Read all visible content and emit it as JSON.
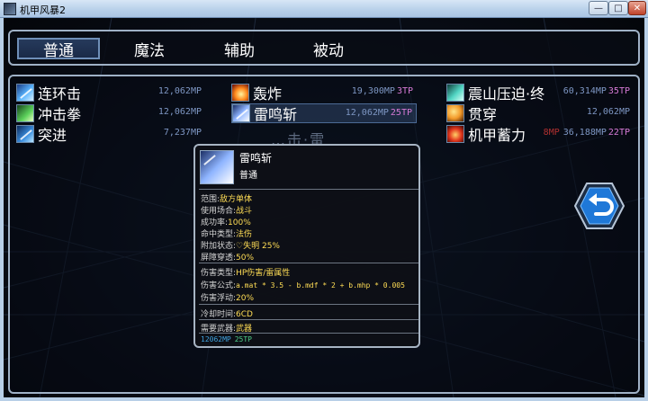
{
  "window": {
    "title": "机甲风暴2",
    "controls": {
      "minimize": "—",
      "maximize": "□",
      "close": "✕"
    }
  },
  "tabs": [
    {
      "label": "普通",
      "active": true
    },
    {
      "label": "魔法",
      "active": false
    },
    {
      "label": "辅助",
      "active": false
    },
    {
      "label": "被动",
      "active": false
    }
  ],
  "skills": [
    {
      "name": "连环击",
      "mp": "12,062MP",
      "tp": "",
      "icon": "blue-slash-icon"
    },
    {
      "name": "冲击拳",
      "mp": "12,062MP",
      "tp": "",
      "icon": "green-fist-icon"
    },
    {
      "name": "突进",
      "mp": "7,237MP",
      "tp": "",
      "icon": "blue-dash-icon"
    },
    {
      "name": "轰炸",
      "mp": "19,300MP",
      "tp": "3TP",
      "icon": "fire-blast-icon"
    },
    {
      "name": "雷鸣斩",
      "mp": "12,062MP",
      "tp": "25TP",
      "icon": "lightning-slash-icon",
      "selected": true
    },
    {
      "name": "震山压迫·终",
      "mp": "60,314MP",
      "tp": "35TP",
      "icon": "teal-quake-icon"
    },
    {
      "name": "贯穿",
      "mp": "12,062MP",
      "tp": "",
      "icon": "orange-pierce-icon"
    },
    {
      "name": "机甲蓄力",
      "mp": "36,188MP",
      "tp": "22TP",
      "icon": "red-charge-icon"
    }
  ],
  "partially_hidden_skill": "…击·雷",
  "partially_hidden_cost_fragment": "8MP",
  "tooltip": {
    "title": "雷鸣斩",
    "category": "普通",
    "attributes": [
      {
        "label": "范围:",
        "value": "敌方单体"
      },
      {
        "label": "使用场合:",
        "value": "战斗"
      },
      {
        "label": "成功率:",
        "value": "100%"
      },
      {
        "label": "命中类型:",
        "value": "法伤"
      },
      {
        "label": "附加状态:",
        "value": "♡失明 25%"
      },
      {
        "label": "屏障穿透:",
        "value": "50%"
      }
    ],
    "damage": [
      {
        "label": "伤害类型:",
        "value": "HP伤害/雷属性"
      },
      {
        "label": "伤害公式:",
        "value": "a.mat * 3.5 - b.mdf * 2 + b.mhp * 0.005"
      },
      {
        "label": "伤害浮动:",
        "value": "20%"
      }
    ],
    "cooldown": {
      "label": "冷却时间:",
      "value": "6CD"
    },
    "weapon": {
      "label": "需要武器:",
      "value": "武器"
    },
    "footer": {
      "mp": "12062MP",
      "tp": "25TP"
    }
  },
  "return_button": {
    "icon": "return-arrow-icon"
  },
  "colors": {
    "mp_text": "#7e97c4",
    "tp_text": "#d67ad6",
    "tooltip_value": "#ffdd55",
    "panel_border": "#9fb1c6",
    "return_button": "#1f78d8"
  }
}
